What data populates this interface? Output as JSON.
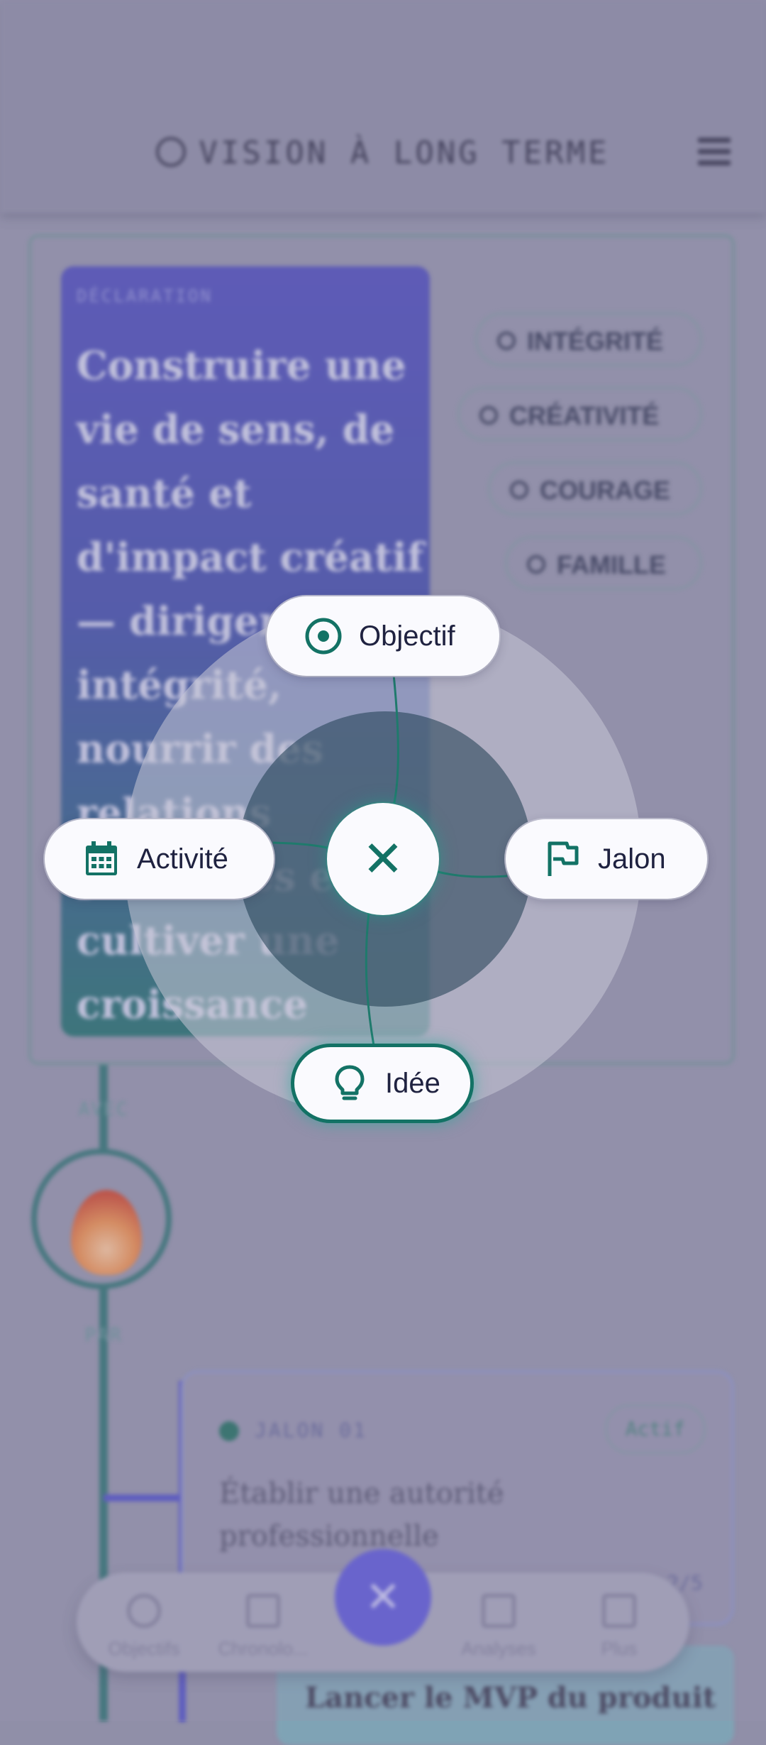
{
  "header": {
    "title": "VISION À LONG TERME"
  },
  "declaration": {
    "label": "DÉCLARATION",
    "text": "Construire une vie de sens, de santé et d'impact créatif — diriger avec intégrité, nourrir des relations profondes et cultiver une croissance continue."
  },
  "values": [
    "INTÉGRITÉ",
    "CRÉATIVITÉ",
    "COURAGE",
    "FAMILLE"
  ],
  "timeline": {
    "label_top": "AVEC",
    "label_bottom": "PAR"
  },
  "milestone": {
    "label": "JALON 01",
    "status": "Actif",
    "title": "Établir une autorité professionnelle",
    "progress_text": "2/5"
  },
  "next_card": {
    "title": "Lancer le MVP du produit"
  },
  "bottom_nav": {
    "items": [
      "Objectifs",
      "Chronolo...",
      "Analyses",
      "Plus"
    ],
    "fab_icon": "close-icon"
  },
  "quick_actions": {
    "objectif": "Objectif",
    "activite": "Activité",
    "jalon": "Jalon",
    "idee": "Idée",
    "close_icon": "close-icon"
  },
  "colors": {
    "accent": "#137265",
    "fab": "#5a55d6",
    "declaration": "#4b49b9"
  }
}
